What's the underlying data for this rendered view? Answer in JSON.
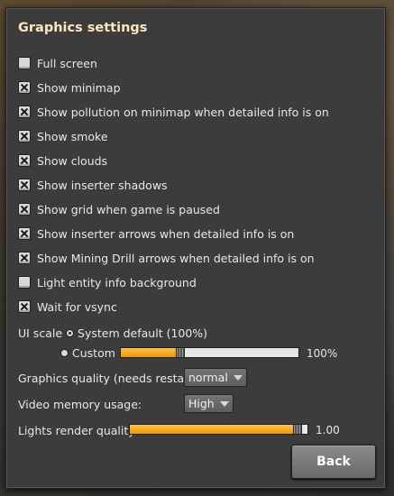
{
  "window": {
    "title": "Graphics settings"
  },
  "checkboxes": [
    {
      "label": "Full screen",
      "checked": false
    },
    {
      "label": "Show minimap",
      "checked": true
    },
    {
      "label": "Show pollution on minimap when detailed info is on",
      "checked": true
    },
    {
      "label": "Show smoke",
      "checked": true
    },
    {
      "label": "Show clouds",
      "checked": true
    },
    {
      "label": "Show inserter shadows",
      "checked": true
    },
    {
      "label": "Show grid when game is paused",
      "checked": true
    },
    {
      "label": "Show inserter arrows when detailed info is on",
      "checked": true
    },
    {
      "label": "Show Mining Drill arrows when detailed info is on",
      "checked": true
    },
    {
      "label": "Light entity info background",
      "checked": false
    },
    {
      "label": "Wait for vsync",
      "checked": true
    }
  ],
  "ui_scale": {
    "label": "UI scale",
    "option_default": "System default (100%)",
    "option_custom": "Custom",
    "selected": "System default (100%)",
    "custom_value_text": "100%",
    "custom_slider_fraction": 0.36
  },
  "graphics_quality": {
    "label": "Graphics quality (needs restart):",
    "value": "normal"
  },
  "video_memory": {
    "label": "Video memory usage:",
    "value": "High"
  },
  "lights_quality": {
    "label": "Lights render quality",
    "value_text": "1.00",
    "slider_fraction": 0.97
  },
  "buttons": {
    "back": "Back"
  },
  "colors": {
    "accent_orange": "#f5a623",
    "title_text": "#ffe6c0",
    "panel": "#3c3c3c"
  }
}
